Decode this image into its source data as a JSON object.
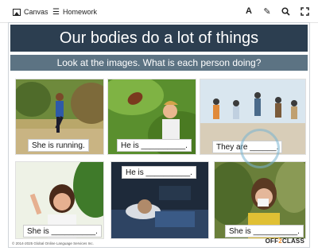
{
  "toolbar": {
    "canvas_label": "Canvas",
    "homework_label": "Homework"
  },
  "icons": {
    "canvas": "image-icon",
    "homework": "list-icon",
    "text": "text-icon",
    "pen": "pencil-icon",
    "search": "search-icon",
    "fullscreen": "expand-icon"
  },
  "slide": {
    "title": "Our bodies do a lot of things",
    "subtitle": "Look at the images. What is each person doing?",
    "captions": [
      "She is running.",
      "He is __________.",
      "They are ______.",
      "She is __________.",
      "He is __________.",
      "She is __________."
    ],
    "copyright": "© 2014-2025 Global Online Language Services Inc.",
    "logo_main": "OFF",
    "logo_accent": "2",
    "logo_end": "CLASS"
  },
  "colors": {
    "title_bg": "#2c3e50",
    "subtitle_bg": "#5c7383",
    "logo_accent": "#f28c28"
  }
}
